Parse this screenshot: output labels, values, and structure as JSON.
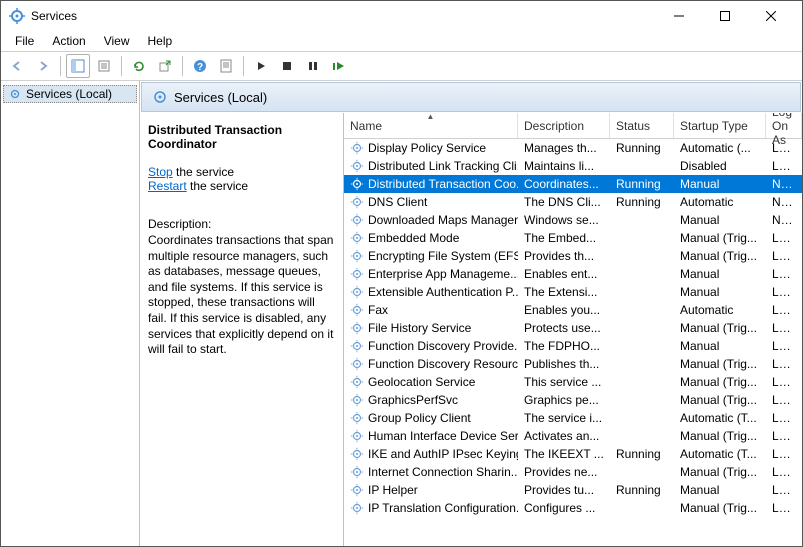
{
  "window": {
    "title": "Services"
  },
  "menu": {
    "file": "File",
    "action": "Action",
    "view": "View",
    "help": "Help"
  },
  "tree": {
    "root": "Services (Local)"
  },
  "content_header": "Services (Local)",
  "detail": {
    "title": "Distributed Transaction Coordinator",
    "stop_label": "Stop",
    "stop_suffix": " the service",
    "restart_label": "Restart",
    "restart_suffix": " the service",
    "desc_label": "Description:",
    "desc": "Coordinates transactions that span multiple resource managers, such as databases, message queues, and file systems. If this service is stopped, these transactions will fail. If this service is disabled, any services that explicitly depend on it will fail to start."
  },
  "columns": {
    "name": "Name",
    "desc": "Description",
    "status": "Status",
    "startup": "Startup Type",
    "logon": "Log On As"
  },
  "services": [
    {
      "name": "Display Policy Service",
      "desc": "Manages th...",
      "status": "Running",
      "startup": "Automatic (...",
      "logon": "Loca"
    },
    {
      "name": "Distributed Link Tracking Cli...",
      "desc": "Maintains li...",
      "status": "",
      "startup": "Disabled",
      "logon": "Loca"
    },
    {
      "name": "Distributed Transaction Coo...",
      "desc": "Coordinates...",
      "status": "Running",
      "startup": "Manual",
      "logon": "Netw",
      "selected": true
    },
    {
      "name": "DNS Client",
      "desc": "The DNS Cli...",
      "status": "Running",
      "startup": "Automatic",
      "logon": "Netw"
    },
    {
      "name": "Downloaded Maps Manager",
      "desc": "Windows se...",
      "status": "",
      "startup": "Manual",
      "logon": "Netw"
    },
    {
      "name": "Embedded Mode",
      "desc": "The Embed...",
      "status": "",
      "startup": "Manual (Trig...",
      "logon": "Loca"
    },
    {
      "name": "Encrypting File System (EFS)",
      "desc": "Provides th...",
      "status": "",
      "startup": "Manual (Trig...",
      "logon": "Loca"
    },
    {
      "name": "Enterprise App Manageme...",
      "desc": "Enables ent...",
      "status": "",
      "startup": "Manual",
      "logon": "Loca"
    },
    {
      "name": "Extensible Authentication P...",
      "desc": "The Extensi...",
      "status": "",
      "startup": "Manual",
      "logon": "Loca"
    },
    {
      "name": "Fax",
      "desc": "Enables you...",
      "status": "",
      "startup": "Automatic",
      "logon": "Loca"
    },
    {
      "name": "File History Service",
      "desc": "Protects use...",
      "status": "",
      "startup": "Manual (Trig...",
      "logon": "Loca"
    },
    {
      "name": "Function Discovery Provide...",
      "desc": "The FDPHO...",
      "status": "",
      "startup": "Manual",
      "logon": "Loca"
    },
    {
      "name": "Function Discovery Resourc...",
      "desc": "Publishes th...",
      "status": "",
      "startup": "Manual (Trig...",
      "logon": "Loca"
    },
    {
      "name": "Geolocation Service",
      "desc": "This service ...",
      "status": "",
      "startup": "Manual (Trig...",
      "logon": "Loca"
    },
    {
      "name": "GraphicsPerfSvc",
      "desc": "Graphics pe...",
      "status": "",
      "startup": "Manual (Trig...",
      "logon": "Loca"
    },
    {
      "name": "Group Policy Client",
      "desc": "The service i...",
      "status": "",
      "startup": "Automatic (T...",
      "logon": "Loca"
    },
    {
      "name": "Human Interface Device Ser...",
      "desc": "Activates an...",
      "status": "",
      "startup": "Manual (Trig...",
      "logon": "Loca"
    },
    {
      "name": "IKE and AuthIP IPsec Keying...",
      "desc": "The IKEEXT ...",
      "status": "Running",
      "startup": "Automatic (T...",
      "logon": "Loca"
    },
    {
      "name": "Internet Connection Sharin...",
      "desc": "Provides ne...",
      "status": "",
      "startup": "Manual (Trig...",
      "logon": "Loca"
    },
    {
      "name": "IP Helper",
      "desc": "Provides tu...",
      "status": "Running",
      "startup": "Manual",
      "logon": "Loca"
    },
    {
      "name": "IP Translation Configuration...",
      "desc": "Configures ...",
      "status": "",
      "startup": "Manual (Trig...",
      "logon": "Loca"
    }
  ]
}
